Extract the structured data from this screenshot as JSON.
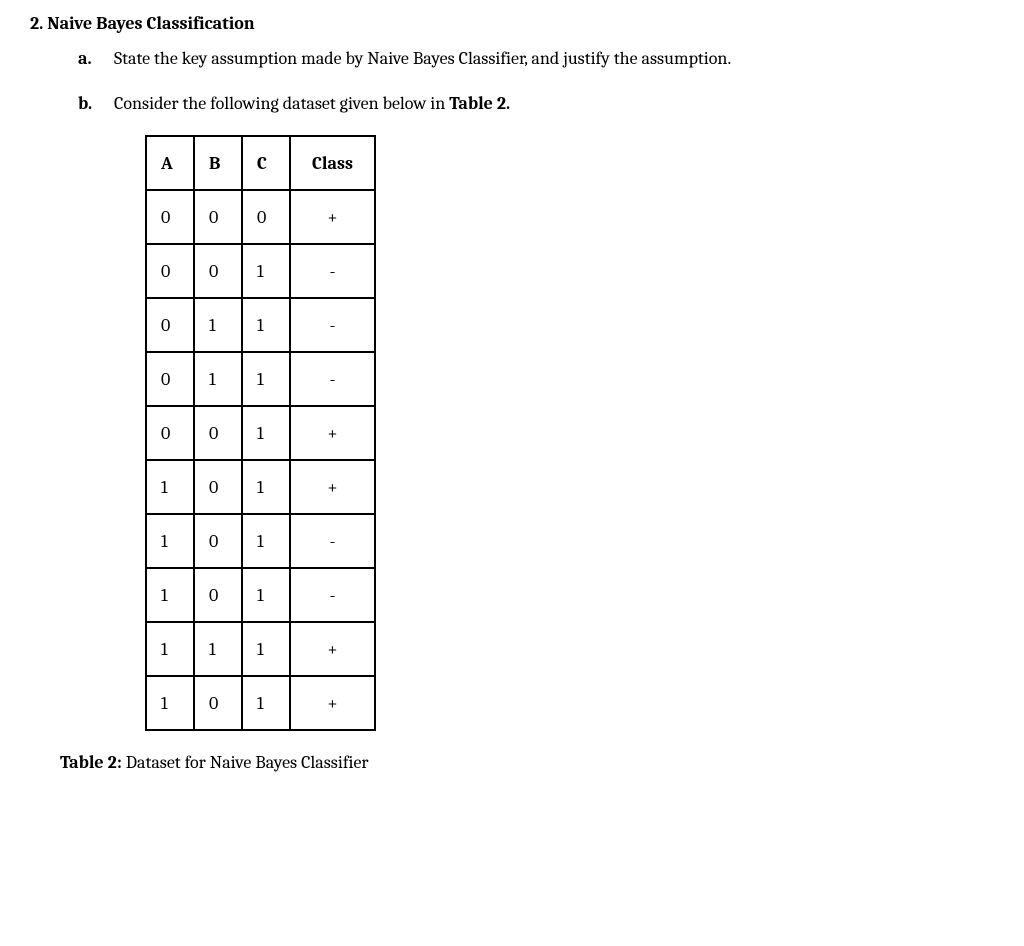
{
  "section": {
    "number": "2.",
    "title": "Naive Bayes Classification"
  },
  "items": {
    "a": {
      "label": "a.",
      "text": "State the key assumption made by Naive Bayes Classifier, and justify the assumption."
    },
    "b": {
      "label": "b.",
      "text_prefix": "Consider the following dataset given below in ",
      "text_bold": "Table 2."
    }
  },
  "table": {
    "headers": {
      "A": "A",
      "B": "B",
      "C": "C",
      "Class": "Class"
    },
    "rows": [
      {
        "A": "0",
        "B": "0",
        "C": "0",
        "Class": "+"
      },
      {
        "A": "0",
        "B": "0",
        "C": "1",
        "Class": "-"
      },
      {
        "A": "0",
        "B": "1",
        "C": "1",
        "Class": "-"
      },
      {
        "A": "0",
        "B": "1",
        "C": "1",
        "Class": "-"
      },
      {
        "A": "0",
        "B": "0",
        "C": "1",
        "Class": "+"
      },
      {
        "A": "1",
        "B": "0",
        "C": "1",
        "Class": "+"
      },
      {
        "A": "1",
        "B": "0",
        "C": "1",
        "Class": "-"
      },
      {
        "A": "1",
        "B": "0",
        "C": "1",
        "Class": "-"
      },
      {
        "A": "1",
        "B": "1",
        "C": "1",
        "Class": "+"
      },
      {
        "A": "1",
        "B": "0",
        "C": "1",
        "Class": "+"
      }
    ]
  },
  "caption": {
    "bold": "Table 2:",
    "text": " Dataset for Naive Bayes Classifier"
  }
}
